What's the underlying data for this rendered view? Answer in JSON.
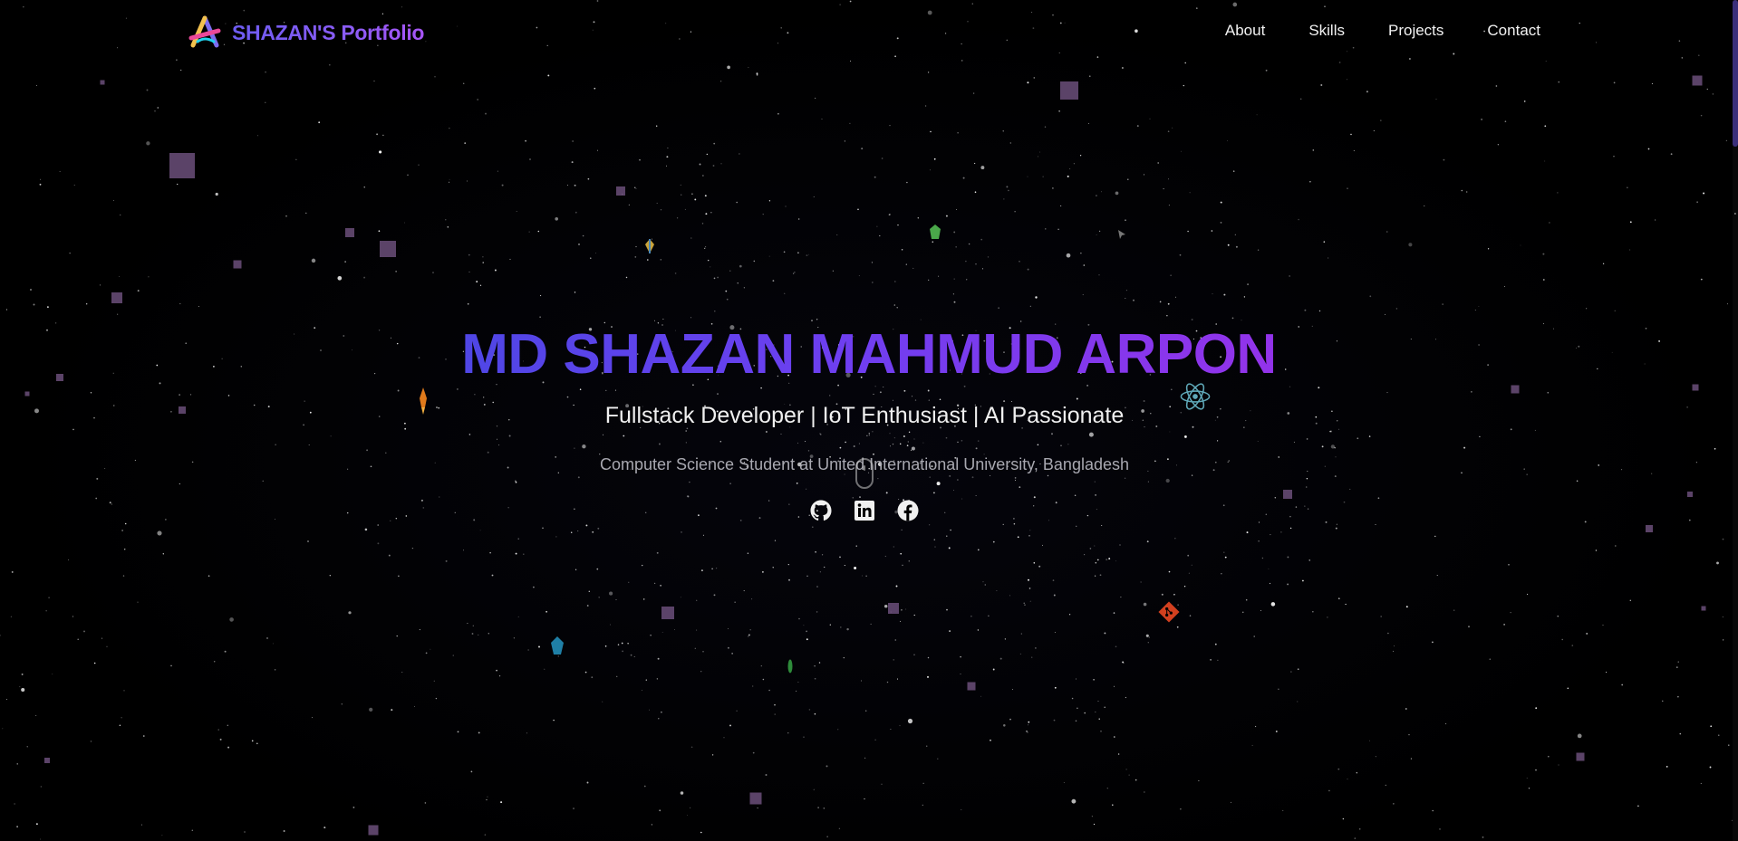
{
  "navbar": {
    "brand": "SHAZAN'S Portfolio",
    "links": [
      {
        "label": "About"
      },
      {
        "label": "Skills"
      },
      {
        "label": "Projects"
      },
      {
        "label": "Contact"
      }
    ]
  },
  "hero": {
    "name": "MD SHAZAN MAHMUD ARPON",
    "subtitle": "Fullstack Developer | IoT Enthusiast | AI Passionate",
    "description": "Computer Science Student at United International University, Bangladesh"
  },
  "social": [
    {
      "icon": "github-icon"
    },
    {
      "icon": "linkedin-icon"
    },
    {
      "icon": "facebook-icon"
    }
  ],
  "floating_icons": [
    "react-atom-icon",
    "git-icon",
    "rocket-icon"
  ],
  "colors": {
    "background": "#000000",
    "accent_start": "#4f46e5",
    "accent_end": "#9333ea",
    "nav_text": "#f2f2f2",
    "particle": "#6b4f7a"
  }
}
